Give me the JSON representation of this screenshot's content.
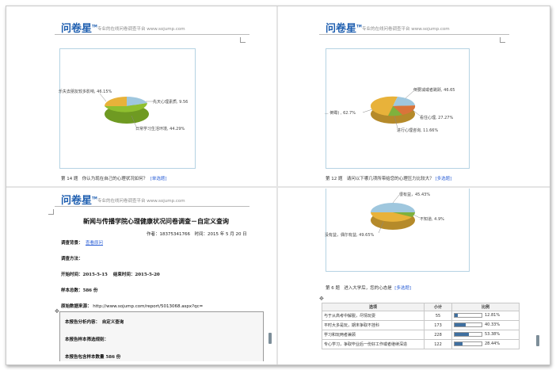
{
  "header": {
    "logo": "问卷星",
    "logo_mark": "TM",
    "slogan": "专业的在线问卷调查平台 www.sojump.com"
  },
  "q1": {
    "chart_data": {
      "type": "pie",
      "slices": [
        {
          "label": "...失去朋友较多影响",
          "value": 46.15,
          "text": "乐失去朋友较多影响, 46.15%",
          "color": "#e8b23a"
        },
        {
          "label": "自我学习生活环境",
          "value": 44.29,
          "text": "日常学习生活环境, 44.29%",
          "color": "#8fbf2f"
        },
        {
          "label": "先天心理素质",
          "value": 9.56,
          "text": "先天心理素质, 9.56",
          "color": "#9fc7de"
        }
      ]
    },
    "question": "第 14 题",
    "question_text": "你认为现在自己的心理状况如何？",
    "type_link": "[单选题]"
  },
  "q2": {
    "chart_data": {
      "type": "pie",
      "slices": [
        {
          "label": "...倒霉",
          "value": 62.7,
          "text": "... 倒霉) , 62.7%",
          "color": "#e8b23a"
        },
        {
          "label": "倒要减或者跳跃",
          "value": 46.65,
          "text": "倒要减或者跳跃, 46.65",
          "color": "#9fc7de"
        },
        {
          "label": "看住心理",
          "value": 27.27,
          "text": "看住心理, 27.27%",
          "color": "#d9743a"
        },
        {
          "label": "进行心理咨询",
          "value": 11.66,
          "text": "进行心理咨询, 11.66%",
          "color": "#7fb13d"
        }
      ]
    },
    "question": "第 12 题",
    "question_text": "请问以下哪几项所带给您的心理压力比较大？",
    "type_link": "[多选题]"
  },
  "q3": {
    "title": "新闻与传播学院心理健康状况问卷调查－自定义查询",
    "author_line": "作者：18375341766　时间：2015 年 5 月 20 日",
    "bg_label": "调查背景：",
    "bg_link": "查看原问",
    "method_label": "调查方法：",
    "start_label": "开始时间：",
    "start_value": "2015-5-15",
    "end_label": "结束时间：",
    "end_value": "2015-5-20",
    "total_label": "样本总数：",
    "total_value": "586 份",
    "source_label": "原始数据来源：",
    "source_value": "http://www.sojump.com/report/5013068.aspx?qc=",
    "box_rows": [
      "本报告分析内容：　自定义查询",
      "本报告样本筛选规则：",
      "本报告包含样本数量 586 份"
    ]
  },
  "q4": {
    "chart_data": {
      "type": "pie",
      "slices": [
        {
          "label": "很有益",
          "value": 45.43,
          "text": "很有益，45.43%",
          "color": "#9fc7de"
        },
        {
          "label": "不知道",
          "value": 4.9,
          "text": "不知道, 4.9%",
          "color": "#7fb13d"
        },
        {
          "label": "没有益",
          "value": 49.65,
          "text": "没有益，偶尔有益, 49.65%",
          "color": "#e8b23a"
        }
      ]
    },
    "question": "第 6 题",
    "question_text": "进入大学后，您的心态是",
    "type_link": "[多选题]",
    "table": {
      "headers": [
        "选项",
        "小计",
        "比例"
      ],
      "rows": [
        {
          "option": "与于从高考中解脱，尽情玩耍",
          "count": "55",
          "pct": "12.81%",
          "fill": 0.1281
        },
        {
          "option": "平时大多是玩，期末争取不挂科",
          "count": "173",
          "pct": "40.33%",
          "fill": 0.4033
        },
        {
          "option": "学习和玩两者兼顾",
          "count": "228",
          "pct": "53.38%",
          "fill": 0.5338
        },
        {
          "option": "专心学习，争取毕业后一份好工作或者继续深造",
          "count": "122",
          "pct": "28.44%",
          "fill": 0.2844
        }
      ]
    }
  }
}
